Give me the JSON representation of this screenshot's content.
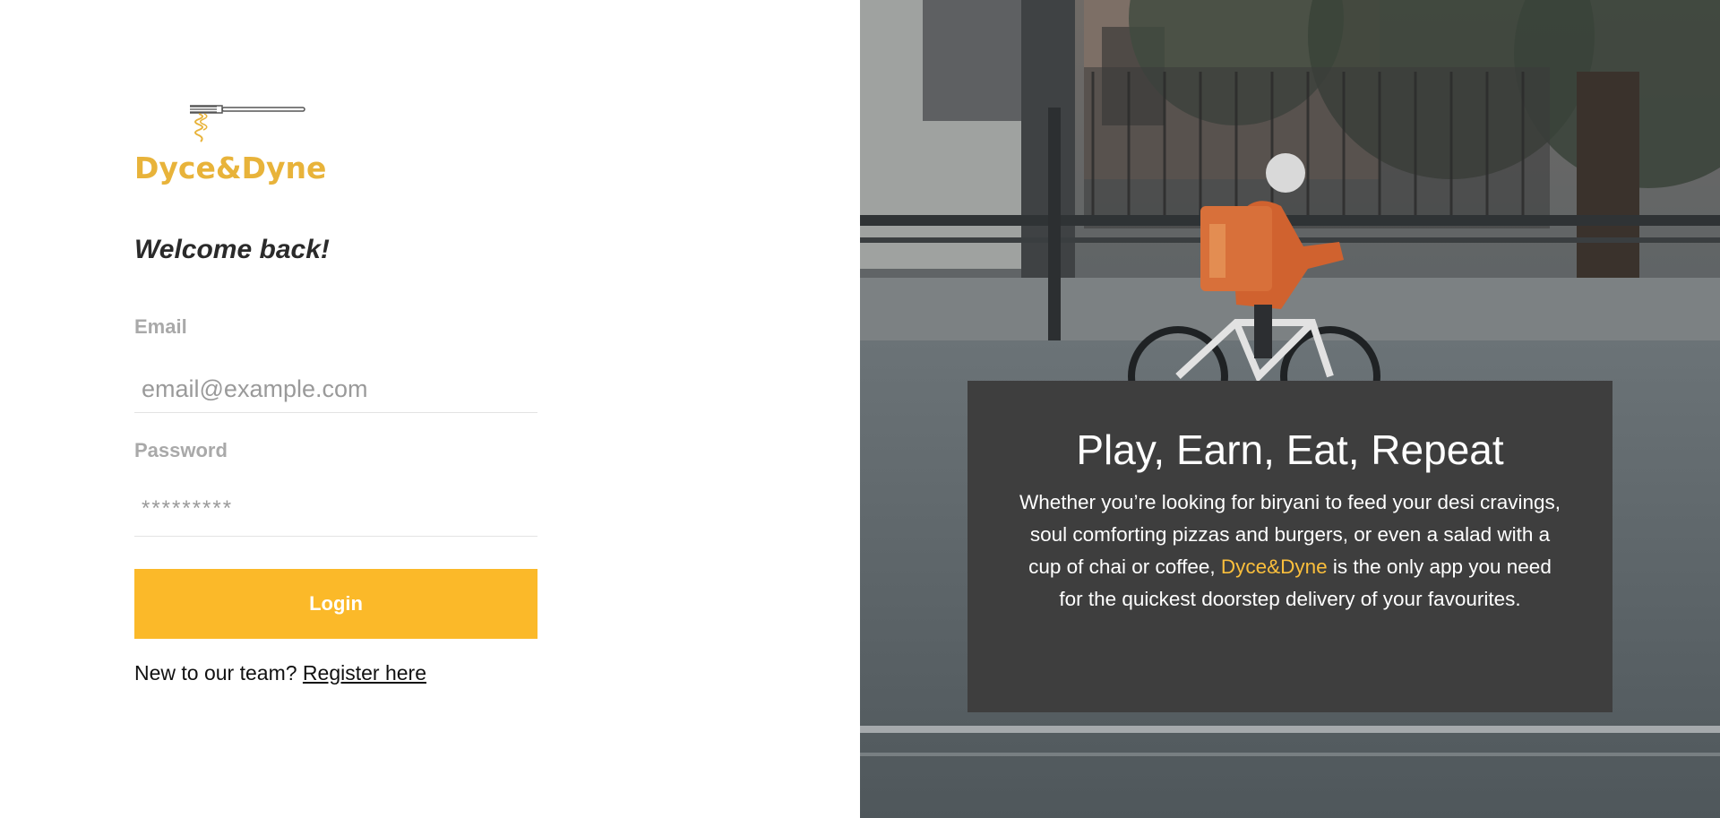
{
  "brand": {
    "name": "Dyce&Dyne",
    "logo_icon": "fork-with-noodles-icon",
    "color": "#e8b33a"
  },
  "login": {
    "heading": "Welcome back!",
    "email_label": "Email",
    "email_placeholder": "email@example.com",
    "email_value": "",
    "password_label": "Password",
    "password_placeholder": "*********",
    "password_value": "",
    "submit_label": "Login",
    "register_prompt": "New to our team?",
    "register_link": "Register here"
  },
  "promo": {
    "title": "Play, Earn, Eat, Repeat",
    "body_before": "Whether you’re looking for biryani to feed your desi cravings, soul comforting pizzas and burgers, or even a salad with a cup of chai or coffee, ",
    "body_brand": "Dyce&Dyne",
    "body_after": " is the only app you need for the quickest doorstep delivery of your favourites."
  },
  "colors": {
    "accent": "#fbb929",
    "card_background": "#3e3e3e",
    "label_gray": "#a9a9a9"
  }
}
